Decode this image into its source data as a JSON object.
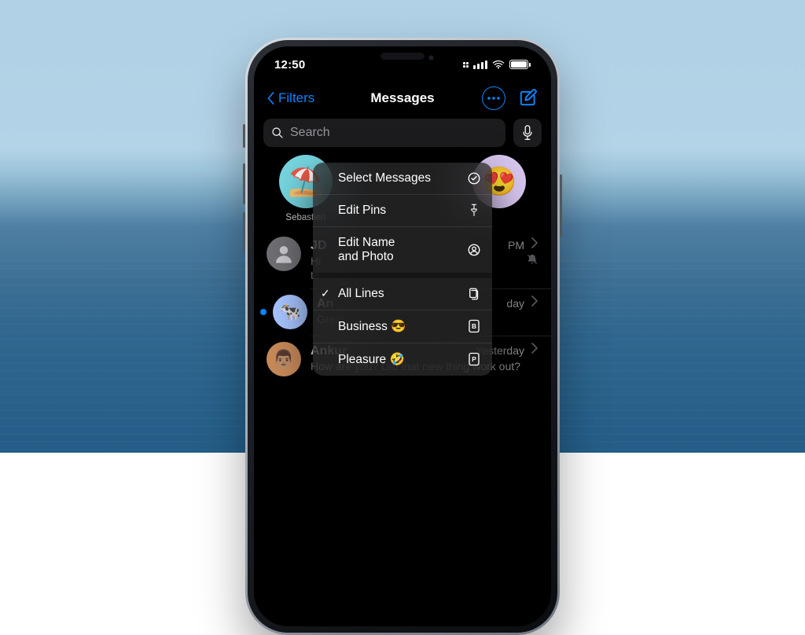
{
  "statusbar": {
    "time": "12:50"
  },
  "nav": {
    "back_label": "Filters",
    "title": "Messages"
  },
  "search": {
    "placeholder": "Search"
  },
  "pins": [
    {
      "emoji": "⛱️",
      "name": "Sebastien",
      "bg": "#77d7e1"
    },
    {
      "emoji": "😍",
      "name": "",
      "bg": "#d8c7f0"
    }
  ],
  "menu": {
    "items": [
      {
        "label": "Select Messages",
        "icon": "check-circle"
      },
      {
        "label": "Edit Pins",
        "icon": "pin"
      },
      {
        "label": "Edit Name\nand Photo",
        "icon": "person-circle"
      },
      {
        "label": "All Lines",
        "icon": "sims",
        "checked": true,
        "divider": true
      },
      {
        "label": "Business 😎",
        "icon": "sim-b"
      },
      {
        "label": "Pleasure 🤣",
        "icon": "sim-p"
      }
    ]
  },
  "conversations": [
    {
      "name": "JD",
      "time": "PM",
      "muted": true,
      "preview": "Hi\nto",
      "avatar_bg": "#6e6e73",
      "avatar_icon": "person"
    },
    {
      "name": "An",
      "time": "day",
      "unread": true,
      "preview": "Great",
      "avatar_bg": "#a7c4ff",
      "avatar_emoji": "🐄"
    },
    {
      "name": "Ankur",
      "time": "Yesterday",
      "preview": "How are you? Did that new thing work out?",
      "avatar_bg": "#c78a59",
      "avatar_emoji": "👨🏽"
    }
  ]
}
